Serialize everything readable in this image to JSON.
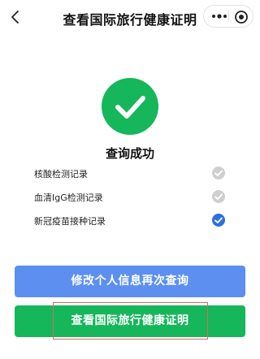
{
  "header": {
    "title": "查看国际旅行健康证明",
    "back_icon": "chevron-left-icon",
    "more_icon": "more-dots-icon",
    "close_icon": "target-circle-icon"
  },
  "result": {
    "icon": "check-circle-icon",
    "title": "查询成功"
  },
  "records": [
    {
      "label": "核酸检测记录",
      "status": "unchecked"
    },
    {
      "label": "血清IgG检测记录",
      "status": "unchecked"
    },
    {
      "label": "新冠疫苗接种记录",
      "status": "checked"
    }
  ],
  "buttons": {
    "modify_label": "修改个人信息再次查询",
    "view_label": "查看国际旅行健康证明"
  },
  "colors": {
    "success_green": "#16b65a",
    "primary_blue": "#5c8ff0",
    "check_blue": "#2f6fe0",
    "check_gray": "#cfcfcf",
    "highlight_red": "#d86a5a"
  }
}
